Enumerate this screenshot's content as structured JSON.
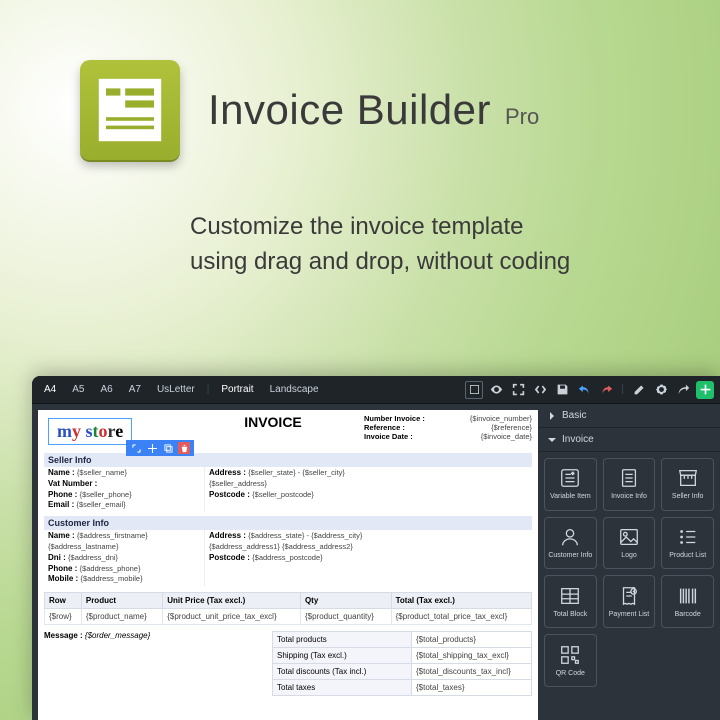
{
  "hero": {
    "title": "Invoice Builder",
    "suffix": "Pro",
    "subtitle_l1": "Customize the invoice template",
    "subtitle_l2": "using drag and drop, without coding"
  },
  "toolbar": {
    "sizes": [
      "A4",
      "A5",
      "A6",
      "A7",
      "UsLetter"
    ],
    "orientations": [
      "Portrait",
      "Landscape"
    ],
    "icons": [
      "layers",
      "eye",
      "fullscreen",
      "code",
      "save",
      "undo",
      "redo",
      "pencil",
      "gear",
      "share",
      "plus"
    ]
  },
  "canvas": {
    "store_logo": "my store",
    "title": "INVOICE",
    "meta": [
      {
        "label": "Number Invoice :",
        "value": "{$invoice_number}"
      },
      {
        "label": "Reference :",
        "value": "{$reference}"
      },
      {
        "label": "Invoice Date :",
        "value": "{$invoice_date}"
      }
    ],
    "seller": {
      "heading": "Seller Info",
      "left": [
        {
          "k": "Name :",
          "v": "{$seller_name}"
        },
        {
          "k": "Vat Number :",
          "v": ""
        },
        {
          "k": "Phone :",
          "v": "{$seller_phone}"
        },
        {
          "k": "Email :",
          "v": "{$seller_email}"
        }
      ],
      "right": [
        {
          "k": "Address :",
          "v": "{$seller_state} - {$seller_city}"
        },
        {
          "k": "",
          "v": "{$seller_address}"
        },
        {
          "k": "Postcode :",
          "v": "{$seller_postcode}"
        }
      ]
    },
    "customer": {
      "heading": "Customer Info",
      "left": [
        {
          "k": "Name :",
          "v": "{$address_firstname} {$address_lastname}"
        },
        {
          "k": "Dni :",
          "v": "{$address_dni}"
        },
        {
          "k": "Phone :",
          "v": "{$address_phone}"
        },
        {
          "k": "Mobile :",
          "v": "{$address_mobile}"
        }
      ],
      "right": [
        {
          "k": "Address :",
          "v": "{$address_state} - {$address_city}"
        },
        {
          "k": "",
          "v": "{$address_address1} {$address_address2}"
        },
        {
          "k": "Postcode :",
          "v": "{$address_postcode}"
        }
      ]
    },
    "table": {
      "cols": [
        "Row",
        "Product",
        "Unit Price (Tax excl.)",
        "Qty",
        "Total (Tax excl.)"
      ],
      "row": [
        "{$row}",
        "{$product_name}",
        "{$product_unit_price_tax_excl}",
        "{$product_quantity}",
        "{$product_total_price_tax_excl}"
      ]
    },
    "message": {
      "label": "Message :",
      "value": "{$order_message}"
    },
    "totals": [
      {
        "label": "Total products",
        "value": "{$total_products}"
      },
      {
        "label": "Shipping (Tax excl.)",
        "value": "{$total_shipping_tax_excl}"
      },
      {
        "label": "Total discounts (Tax incl.)",
        "value": "{$total_discounts_tax_incl}"
      },
      {
        "label": "Total taxes",
        "value": "{$total_taxes}"
      }
    ]
  },
  "sidebar": {
    "groups": [
      "Basic",
      "Invoice"
    ],
    "items": [
      {
        "name": "Variable Item",
        "icon": "var"
      },
      {
        "name": "Invoice Info",
        "icon": "doc"
      },
      {
        "name": "Seller Info",
        "icon": "shop"
      },
      {
        "name": "Customer Info",
        "icon": "user"
      },
      {
        "name": "Logo",
        "icon": "image"
      },
      {
        "name": "Product List",
        "icon": "list"
      },
      {
        "name": "Total Block",
        "icon": "table"
      },
      {
        "name": "Payment List",
        "icon": "receipt"
      },
      {
        "name": "Barcode",
        "icon": "barcode"
      },
      {
        "name": "QR Code",
        "icon": "qr"
      }
    ]
  }
}
